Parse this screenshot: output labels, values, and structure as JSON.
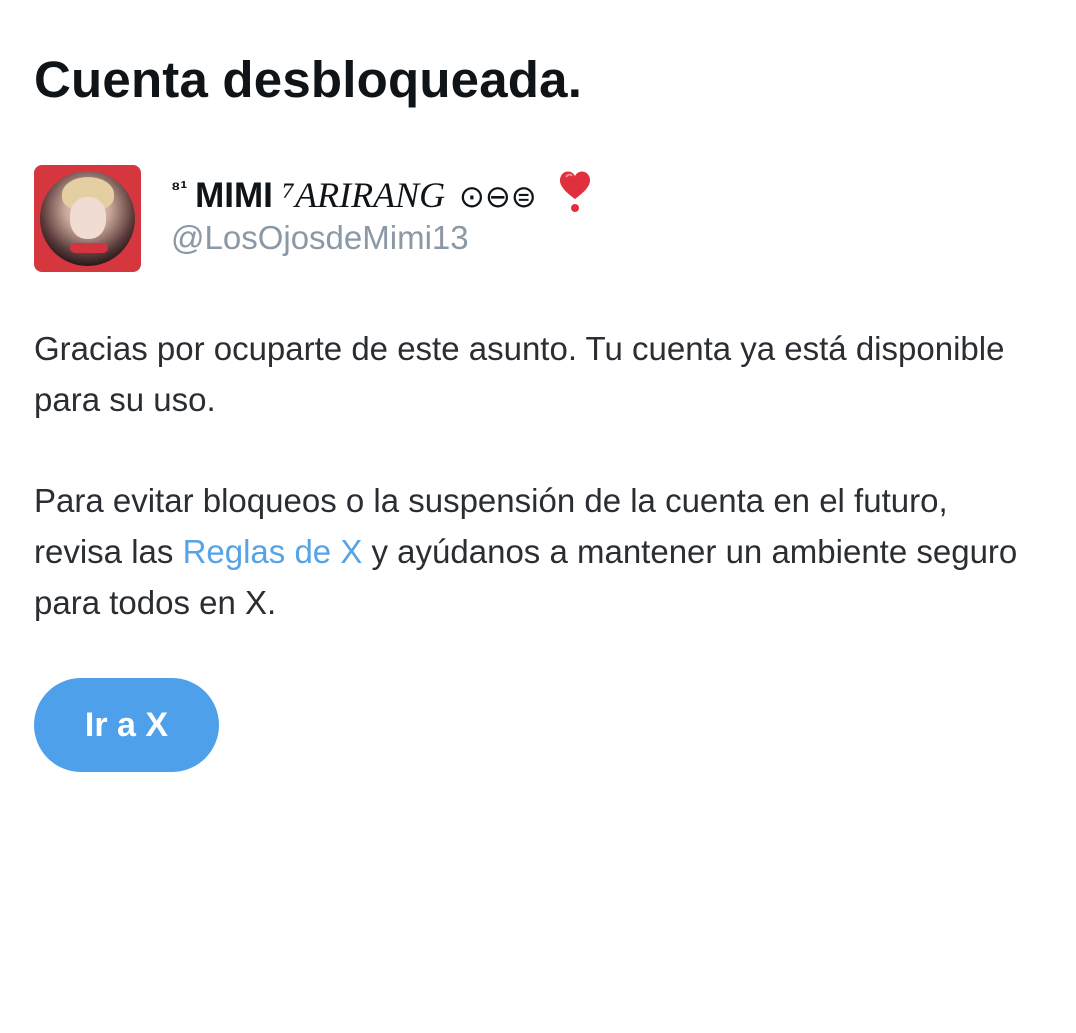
{
  "page": {
    "title": "Cuenta desbloqueada."
  },
  "account": {
    "name_prefix": "⁸¹",
    "name_main": "MIMI",
    "name_sup": "⁷",
    "name_italic": "ARIRANG",
    "name_symbols": "⊙⊖⊜",
    "heart_icon": "red-heart-emoji",
    "handle": "@LosOjosdeMimi13",
    "avatar_icon": "profile-photo"
  },
  "message": {
    "paragraph1": "Gracias por ocuparte de este asunto. Tu cuenta ya está disponible para su uso.",
    "paragraph2_before": "Para evitar bloqueos o la suspensión de la cuenta en el futuro, revisa las ",
    "rules_link": "Reglas de X",
    "paragraph2_after": " y ayúdanos a mantener un ambiente seguro para todos en X."
  },
  "actions": {
    "go_button": "Ir a X"
  },
  "colors": {
    "accent": "#4fa0ea",
    "link": "#56a3e6",
    "muted": "#8b98a5",
    "avatar_frame": "#d6363e"
  }
}
